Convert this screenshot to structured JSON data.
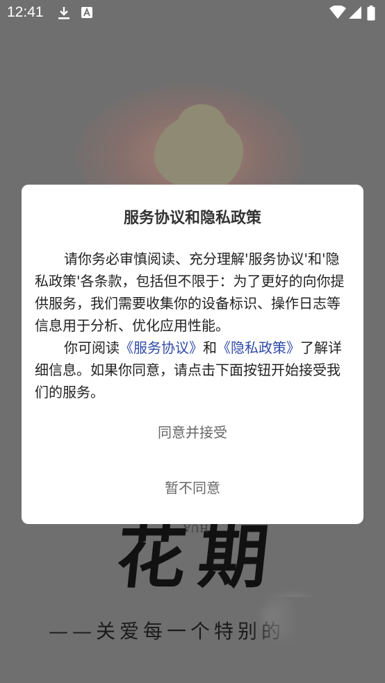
{
  "status_bar": {
    "time": "12:41",
    "icons": [
      "download-icon",
      "text-notification-icon",
      "wifi-icon",
      "signal-icon",
      "battery-icon"
    ]
  },
  "splash": {
    "brand": "花期",
    "brand_side_text": "HUA",
    "tagline": "——关爱每一个特别的"
  },
  "dialog": {
    "title": "服务协议和隐私政策",
    "paragraph1": "请你务必审慎阅读、充分理解'服务协议'和'隐私政策'各条款，包括但不限于：为了更好的向你提供服务，我们需要收集你的设备标识、操作日志等信息用于分析、优化应用性能。",
    "paragraph2_prefix": "你可阅读",
    "link_service": "《服务协议》",
    "connector": "和",
    "link_privacy": "《隐私政策》",
    "paragraph2_suffix": "了解详细信息。如果你同意，请点击下面按钮开始接受我们的服务。",
    "agree_button": "同意并接受",
    "decline_button": "暂不同意"
  },
  "colors": {
    "overlay": "#6f6f6f",
    "link": "#2f4ba8",
    "button_text": "#666666"
  }
}
